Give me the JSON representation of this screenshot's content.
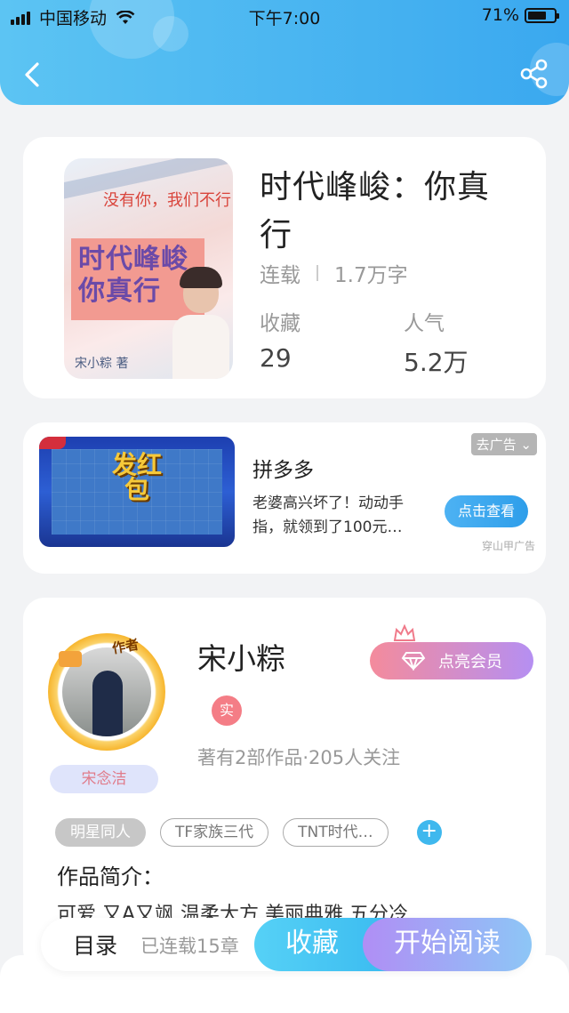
{
  "status_bar": {
    "carrier": "中国移动",
    "time": "下午7:00",
    "battery_pct": "71%",
    "battery_level": 0.71
  },
  "book": {
    "title": "时代峰峻：你真行",
    "status": "连载",
    "word_count": "1.7万字",
    "favorites_label": "收藏",
    "favorites_value": "29",
    "popularity_label": "人气",
    "popularity_value": "5.2万",
    "cover": {
      "subtitle": "没有你，我们不行",
      "title": "时代峰峻你真行",
      "author": "宋小粽 著"
    }
  },
  "ad": {
    "close_label": "去广告",
    "image_text": "发红包",
    "name": "拼多多",
    "description": "老婆高兴坏了！动动手指，就领到了100元…",
    "button_label": "点击查看",
    "source": "穿山甲广告"
  },
  "author": {
    "name": "宋小粽",
    "avatar_tag": "作者",
    "pen_name": "宋念洁",
    "vip_button": "点亮会员",
    "real_badge": "实",
    "stats": "著有2部作品·205人关注",
    "tags": [
      "明星同人",
      "TF家族三代",
      "TNT时代…"
    ],
    "intro_title": "作品简介：",
    "intro_text": "可爱 又A又飒 温柔大方 美丽典雅 五分冷"
  },
  "bottom": {
    "toc_label": "目录",
    "toc_status": "已连载15章",
    "favorite_button": "收藏",
    "read_button": "开始阅读"
  },
  "colors": {
    "header": "#3aa8ef",
    "accent": "#34b6ef",
    "vip": "#b58ff2"
  }
}
